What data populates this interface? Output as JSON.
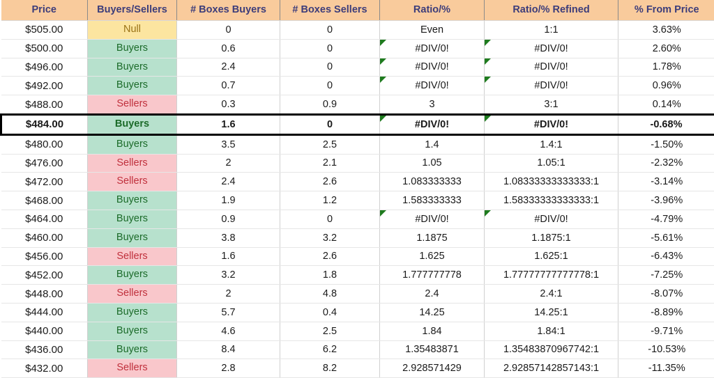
{
  "table": {
    "columns": [
      {
        "key": "price",
        "label": "Price"
      },
      {
        "key": "bs",
        "label": "Buyers/Sellers"
      },
      {
        "key": "boxes_b",
        "label": "# Boxes Buyers"
      },
      {
        "key": "boxes_s",
        "label": "# Boxes Sellers"
      },
      {
        "key": "ratio",
        "label": "Ratio/%"
      },
      {
        "key": "refined",
        "label": "Ratio/% Refined"
      },
      {
        "key": "from",
        "label": "% From Price"
      }
    ],
    "colors": {
      "header_background": "#F9CB9C",
      "header_text": "#3D3D7A",
      "buyers_background": "#B7E1CD",
      "buyers_text": "#1B6B29",
      "sellers_background": "#F9C7CB",
      "sellers_text": "#C0303C",
      "null_background": "#FCE5A0",
      "null_text": "#9A7317",
      "error_indicator": "#1E7B1E",
      "highlight_border": "#000000"
    },
    "rows": [
      {
        "price": "$505.00",
        "bs": "Null",
        "bs_kind": "null",
        "boxes_b": "0",
        "boxes_s": "0",
        "ratio": "Even",
        "ratio_error": false,
        "refined": "1:1",
        "refined_error": false,
        "from": "3.63%",
        "highlighted": false
      },
      {
        "price": "$500.00",
        "bs": "Buyers",
        "bs_kind": "buyers",
        "boxes_b": "0.6",
        "boxes_s": "0",
        "ratio": "#DIV/0!",
        "ratio_error": true,
        "refined": "#DIV/0!",
        "refined_error": true,
        "from": "2.60%",
        "highlighted": false
      },
      {
        "price": "$496.00",
        "bs": "Buyers",
        "bs_kind": "buyers",
        "boxes_b": "2.4",
        "boxes_s": "0",
        "ratio": "#DIV/0!",
        "ratio_error": true,
        "refined": "#DIV/0!",
        "refined_error": true,
        "from": "1.78%",
        "highlighted": false
      },
      {
        "price": "$492.00",
        "bs": "Buyers",
        "bs_kind": "buyers",
        "boxes_b": "0.7",
        "boxes_s": "0",
        "ratio": "#DIV/0!",
        "ratio_error": true,
        "refined": "#DIV/0!",
        "refined_error": true,
        "from": "0.96%",
        "highlighted": false
      },
      {
        "price": "$488.00",
        "bs": "Sellers",
        "bs_kind": "sellers",
        "boxes_b": "0.3",
        "boxes_s": "0.9",
        "ratio": "3",
        "ratio_error": false,
        "refined": "3:1",
        "refined_error": false,
        "from": "0.14%",
        "highlighted": false
      },
      {
        "price": "$484.00",
        "bs": "Buyers",
        "bs_kind": "buyers",
        "boxes_b": "1.6",
        "boxes_s": "0",
        "ratio": "#DIV/0!",
        "ratio_error": true,
        "refined": "#DIV/0!",
        "refined_error": true,
        "from": "-0.68%",
        "highlighted": true
      },
      {
        "price": "$480.00",
        "bs": "Buyers",
        "bs_kind": "buyers",
        "boxes_b": "3.5",
        "boxes_s": "2.5",
        "ratio": "1.4",
        "ratio_error": false,
        "refined": "1.4:1",
        "refined_error": false,
        "from": "-1.50%",
        "highlighted": false
      },
      {
        "price": "$476.00",
        "bs": "Sellers",
        "bs_kind": "sellers",
        "boxes_b": "2",
        "boxes_s": "2.1",
        "ratio": "1.05",
        "ratio_error": false,
        "refined": "1.05:1",
        "refined_error": false,
        "from": "-2.32%",
        "highlighted": false
      },
      {
        "price": "$472.00",
        "bs": "Sellers",
        "bs_kind": "sellers",
        "boxes_b": "2.4",
        "boxes_s": "2.6",
        "ratio": "1.083333333",
        "ratio_error": false,
        "refined": "1.08333333333333:1",
        "refined_error": false,
        "from": "-3.14%",
        "highlighted": false
      },
      {
        "price": "$468.00",
        "bs": "Buyers",
        "bs_kind": "buyers",
        "boxes_b": "1.9",
        "boxes_s": "1.2",
        "ratio": "1.583333333",
        "ratio_error": false,
        "refined": "1.58333333333333:1",
        "refined_error": false,
        "from": "-3.96%",
        "highlighted": false
      },
      {
        "price": "$464.00",
        "bs": "Buyers",
        "bs_kind": "buyers",
        "boxes_b": "0.9",
        "boxes_s": "0",
        "ratio": "#DIV/0!",
        "ratio_error": true,
        "refined": "#DIV/0!",
        "refined_error": true,
        "from": "-4.79%",
        "highlighted": false
      },
      {
        "price": "$460.00",
        "bs": "Buyers",
        "bs_kind": "buyers",
        "boxes_b": "3.8",
        "boxes_s": "3.2",
        "ratio": "1.1875",
        "ratio_error": false,
        "refined": "1.1875:1",
        "refined_error": false,
        "from": "-5.61%",
        "highlighted": false
      },
      {
        "price": "$456.00",
        "bs": "Sellers",
        "bs_kind": "sellers",
        "boxes_b": "1.6",
        "boxes_s": "2.6",
        "ratio": "1.625",
        "ratio_error": false,
        "refined": "1.625:1",
        "refined_error": false,
        "from": "-6.43%",
        "highlighted": false
      },
      {
        "price": "$452.00",
        "bs": "Buyers",
        "bs_kind": "buyers",
        "boxes_b": "3.2",
        "boxes_s": "1.8",
        "ratio": "1.777777778",
        "ratio_error": false,
        "refined": "1.77777777777778:1",
        "refined_error": false,
        "from": "-7.25%",
        "highlighted": false
      },
      {
        "price": "$448.00",
        "bs": "Sellers",
        "bs_kind": "sellers",
        "boxes_b": "2",
        "boxes_s": "4.8",
        "ratio": "2.4",
        "ratio_error": false,
        "refined": "2.4:1",
        "refined_error": false,
        "from": "-8.07%",
        "highlighted": false
      },
      {
        "price": "$444.00",
        "bs": "Buyers",
        "bs_kind": "buyers",
        "boxes_b": "5.7",
        "boxes_s": "0.4",
        "ratio": "14.25",
        "ratio_error": false,
        "refined": "14.25:1",
        "refined_error": false,
        "from": "-8.89%",
        "highlighted": false
      },
      {
        "price": "$440.00",
        "bs": "Buyers",
        "bs_kind": "buyers",
        "boxes_b": "4.6",
        "boxes_s": "2.5",
        "ratio": "1.84",
        "ratio_error": false,
        "refined": "1.84:1",
        "refined_error": false,
        "from": "-9.71%",
        "highlighted": false
      },
      {
        "price": "$436.00",
        "bs": "Buyers",
        "bs_kind": "buyers",
        "boxes_b": "8.4",
        "boxes_s": "6.2",
        "ratio": "1.35483871",
        "ratio_error": false,
        "refined": "1.35483870967742:1",
        "refined_error": false,
        "from": "-10.53%",
        "highlighted": false
      },
      {
        "price": "$432.00",
        "bs": "Sellers",
        "bs_kind": "sellers",
        "boxes_b": "2.8",
        "boxes_s": "8.2",
        "ratio": "2.928571429",
        "ratio_error": false,
        "refined": "2.92857142857143:1",
        "refined_error": false,
        "from": "-11.35%",
        "highlighted": false
      }
    ]
  }
}
